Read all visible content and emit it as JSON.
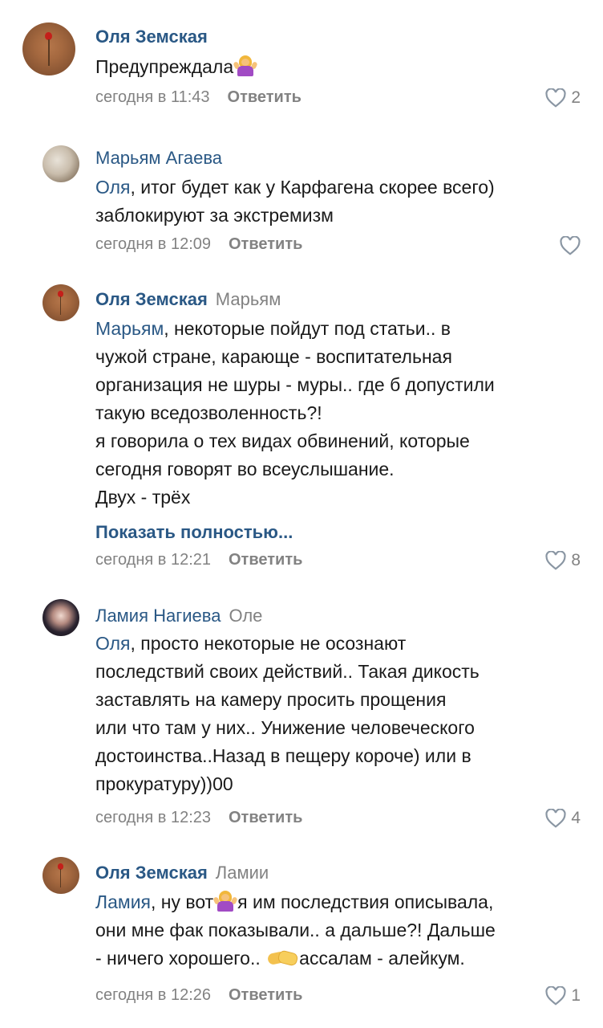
{
  "comments": [
    {
      "author": "Оля Земская",
      "reply_to": "",
      "lines": [
        "Предупреждала"
      ],
      "time": "сегодня в 11:43",
      "reply_label": "Ответить",
      "likes": "2"
    },
    {
      "author": "Марьям Агаева",
      "reply_to": "",
      "mention": "Оля",
      "lines": [
        ", итог будет как у Карфагена скорее всего)",
        "заблокируют за экстремизм"
      ],
      "time": "сегодня в 12:09",
      "reply_label": "Ответить",
      "likes": ""
    },
    {
      "author": "Оля Земская",
      "reply_to": "Марьям",
      "mention": "Марьям",
      "lines": [
        ", некоторые пойдут под статьи.. в",
        "чужой стране, карающе - воспитательная",
        "организация не шуры - муры.. где б допустили",
        "такую вседозволенность?!",
        "я говорила о тех видах обвинений, которые",
        "сегодня говорят во всеуслышание.",
        "Двух - трёх"
      ],
      "show_more": "Показать полностью...",
      "time": "сегодня в 12:21",
      "reply_label": "Ответить",
      "likes": "8"
    },
    {
      "author": "Ламия Нагиева",
      "reply_to": "Оле",
      "mention": "Оля",
      "lines": [
        ", просто некоторые не осознают",
        "последствий своих действий.. Такая дикость",
        "заставлять на камеру просить прощения",
        "или что там у них.. Унижение человеческого",
        "достоинства..Назад в пещеру короче) или в",
        "прокуратуру))00"
      ],
      "time": "сегодня в 12:23",
      "reply_label": "Ответить",
      "likes": "4"
    },
    {
      "author": "Оля Земская",
      "reply_to": "Ламии",
      "mention": "Ламия",
      "lines": [
        ", ну вот",
        "я им последствия описывала,",
        "они мне фак показывали.. а дальше?! Дальше",
        "- ничего хорошего..",
        "ассалам - алейкум."
      ],
      "time": "сегодня в 12:26",
      "reply_label": "Ответить",
      "likes": "1"
    }
  ],
  "colors": {
    "link": "#2a5885",
    "meta": "#828282",
    "text": "#1a1a1a"
  },
  "icons": [
    "heart-icon",
    "woman-shrugging-emoji",
    "handshake-emoji"
  ]
}
